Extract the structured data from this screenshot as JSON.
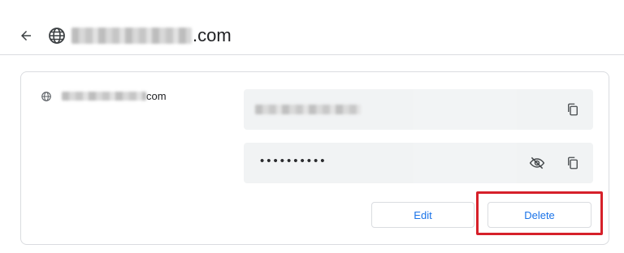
{
  "header": {
    "back_icon": "arrow-back-icon",
    "globe_icon": "globe-icon",
    "title_suffix": ".com"
  },
  "entry": {
    "site_icon": "globe-icon",
    "site_suffix": "com",
    "password_masked": "••••••••••",
    "copy_icon": "copy-icon",
    "visibility_icon": "eye-off-icon",
    "edit_label": "Edit",
    "delete_label": "Delete"
  },
  "annotation": {
    "highlight_color": "#d6202a",
    "highlighted_element": "delete-button"
  },
  "colors": {
    "accent": "#1a73e8",
    "field_bg": "#f1f3f4",
    "border": "#dadce0"
  }
}
